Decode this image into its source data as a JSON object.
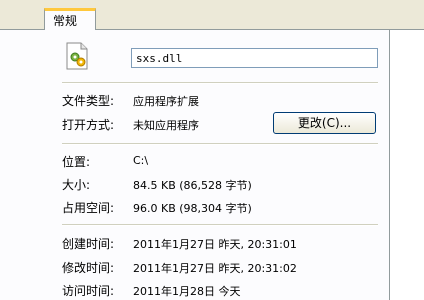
{
  "tabs": [
    {
      "label": "常规"
    }
  ],
  "file": {
    "name": "sxs.dll",
    "icon": "dll-file-icon"
  },
  "rows": {
    "type": {
      "label": "文件类型:",
      "value": "应用程序扩展"
    },
    "opens": {
      "label": "打开方式:",
      "value": "未知应用程序",
      "button": "更改(C)..."
    },
    "location": {
      "label": "位置:",
      "value": "C:\\"
    },
    "size": {
      "label": "大小:",
      "value": "84.5 KB (86,528 字节)"
    },
    "disk_size": {
      "label": "占用空间:",
      "value": "96.0 KB (98,304 字节)"
    },
    "created": {
      "label": "创建时间:",
      "value": "2011年1月27日 昨天, 20:31:01"
    },
    "modified": {
      "label": "修改时间:",
      "value": "2011年1月27日 昨天, 20:31:02"
    },
    "accessed": {
      "label": "访问时间:",
      "value": "2011年1月28日 今天"
    }
  }
}
